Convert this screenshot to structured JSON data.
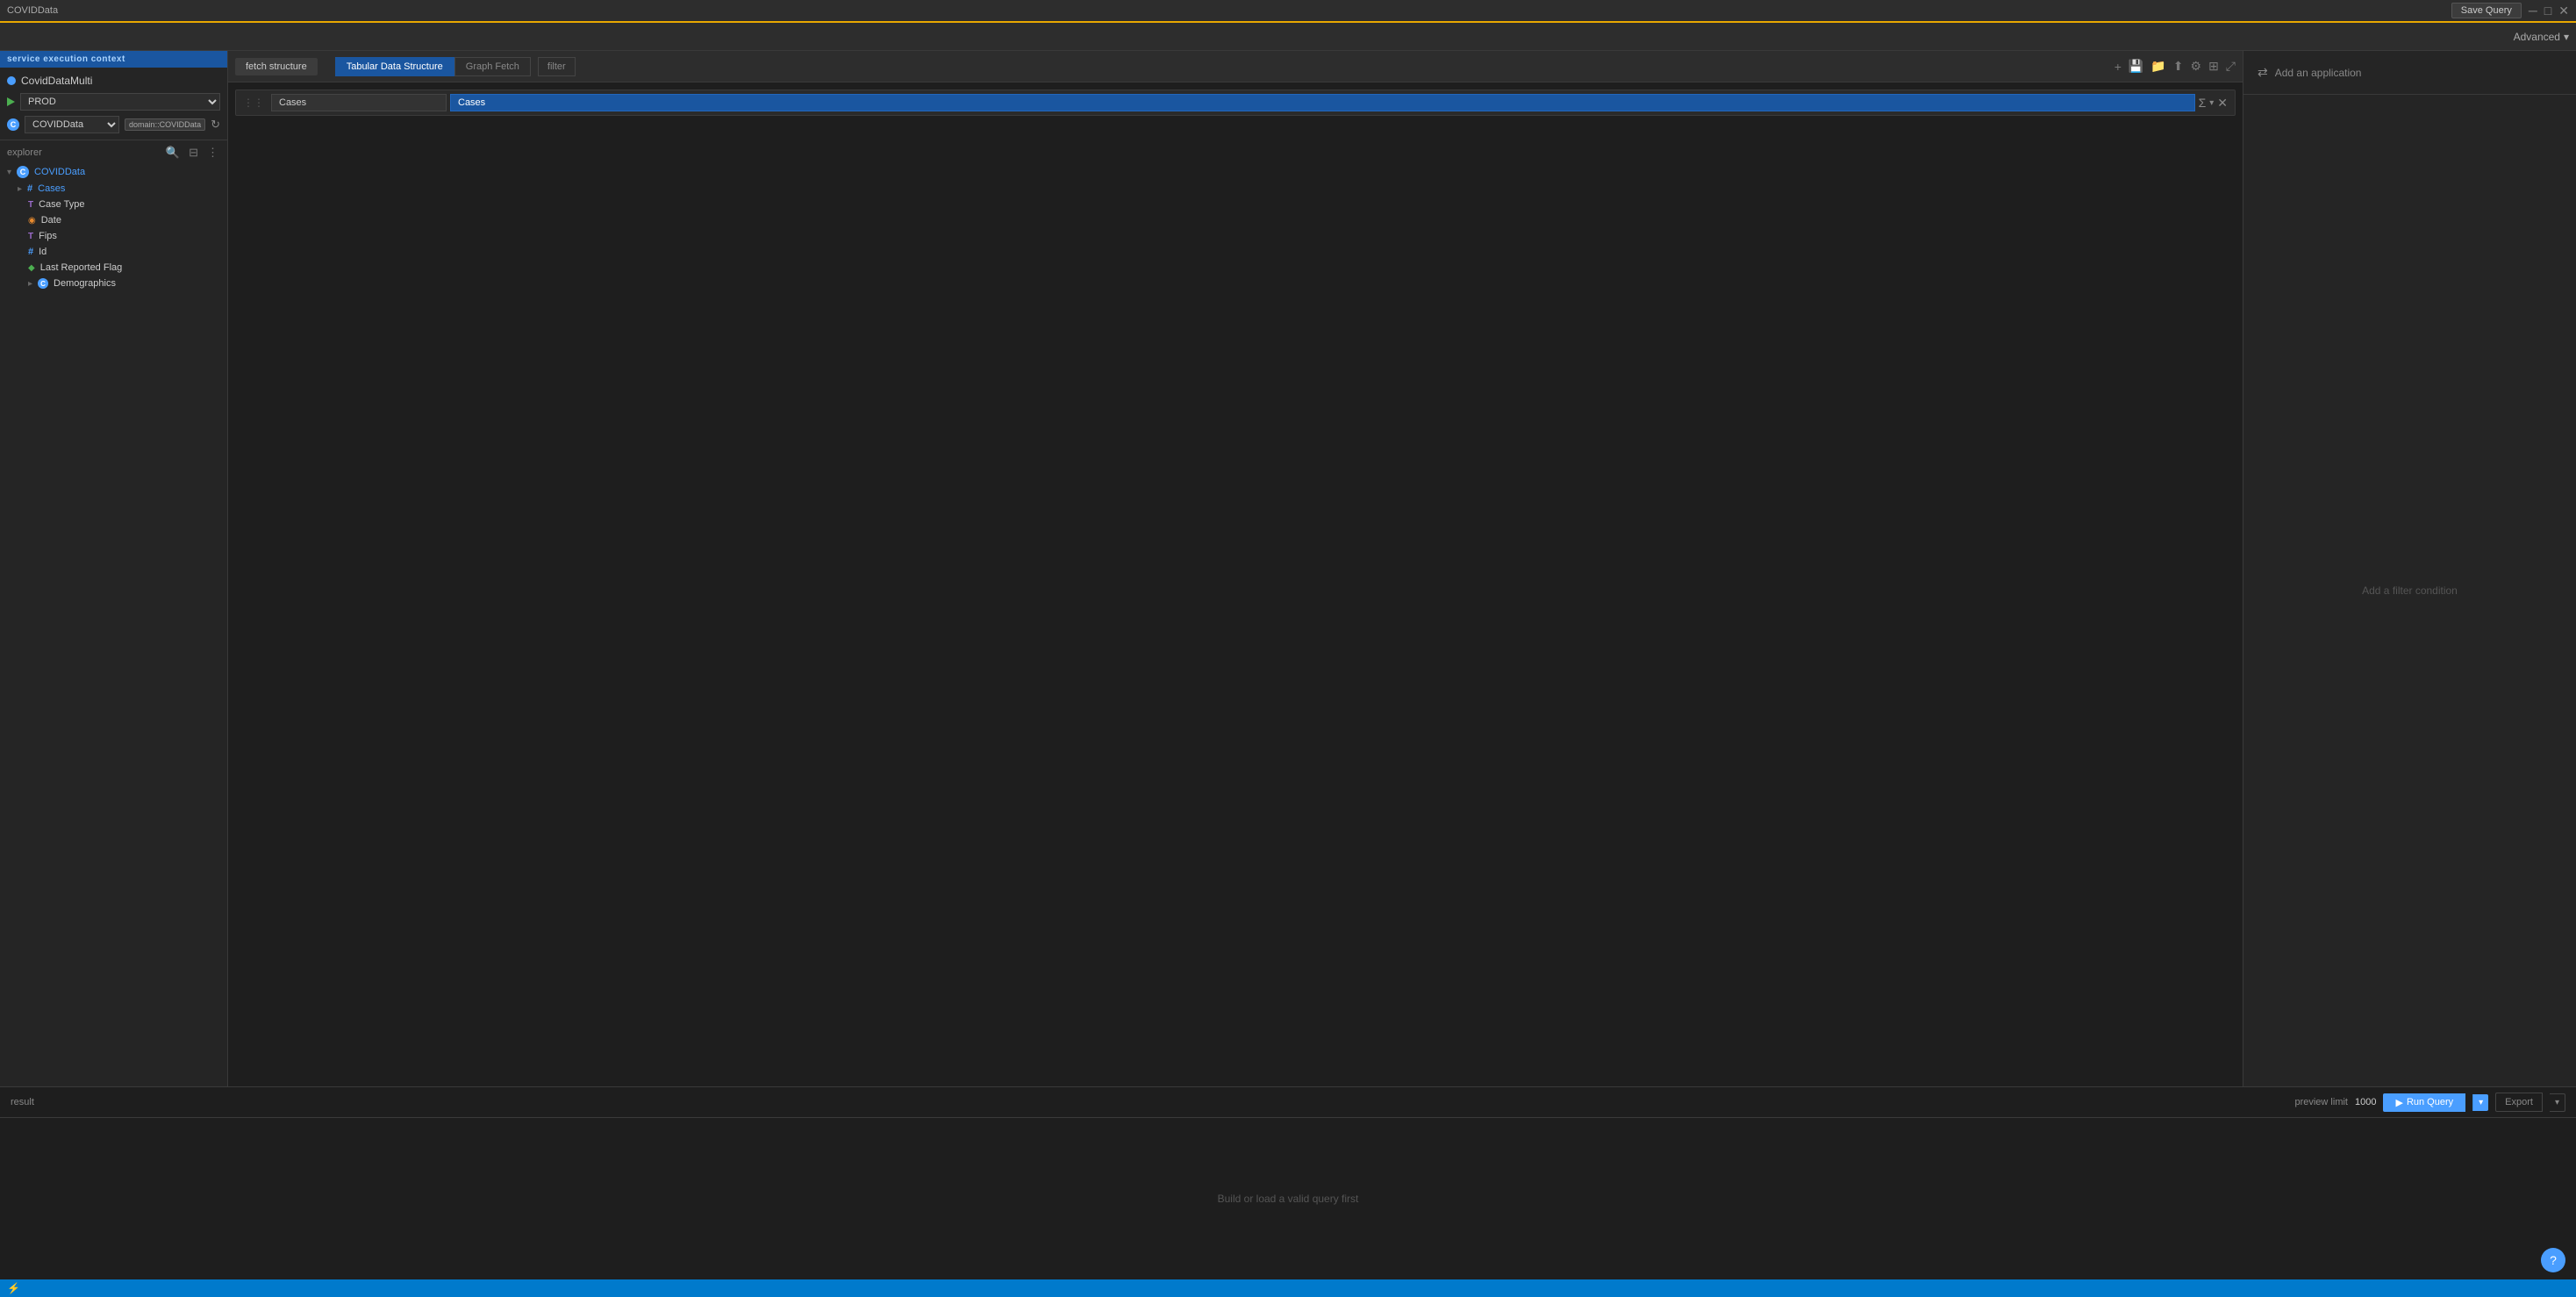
{
  "top_bar": {
    "left_text": "COVIDData",
    "save_query_label": "Save Query",
    "minimize_icon": "─",
    "maximize_icon": "□",
    "close_icon": "✕"
  },
  "advanced_bar": {
    "label": "Advanced",
    "dropdown_icon": "▾"
  },
  "sidebar": {
    "service_context_label": "service execution context",
    "covid_data_multi": "CovidDataMulti",
    "prod_label": "PROD",
    "covid_data_label": "COVIDData",
    "domain_badge": "domain::COVIDData",
    "explorer_label": "explorer",
    "tree": {
      "root": "COVIDData",
      "children": [
        {
          "name": "Cases",
          "type": "hash",
          "level": 1
        },
        {
          "name": "Case Type",
          "type": "T",
          "level": 2
        },
        {
          "name": "Date",
          "type": "date",
          "level": 2
        },
        {
          "name": "Fips",
          "type": "T",
          "level": 2
        },
        {
          "name": "Id",
          "type": "hash",
          "level": 2
        },
        {
          "name": "Last Reported Flag",
          "type": "bool",
          "level": 2
        },
        {
          "name": "Demographics",
          "type": "c",
          "level": 2
        }
      ]
    }
  },
  "fetch_tabs": [
    {
      "label": "fetch structure",
      "active": true
    }
  ],
  "structure_tabs": [
    {
      "label": "Tabular Data Structure",
      "active": true
    },
    {
      "label": "Graph Fetch",
      "active": false
    },
    {
      "label": "filter",
      "active": false
    }
  ],
  "toolbar_icons": [
    {
      "name": "plus-icon",
      "symbol": "+"
    },
    {
      "name": "save-icon",
      "symbol": "💾"
    },
    {
      "name": "folder-icon",
      "symbol": "📁"
    },
    {
      "name": "share-icon",
      "symbol": "⬆"
    },
    {
      "name": "settings-icon",
      "symbol": "⚙"
    },
    {
      "name": "layout-icon",
      "symbol": "⊞"
    },
    {
      "name": "expand-icon",
      "symbol": "⤢"
    }
  ],
  "query_row": {
    "drag_handle": "⋮⋮",
    "label": "Cases",
    "value": "Cases",
    "sigma": "Σ",
    "dropdown": "▾",
    "close": "✕"
  },
  "right_panel": {
    "add_app_icon": "⇄",
    "add_app_text": "Add an application",
    "filter_placeholder": "Add a filter condition"
  },
  "result": {
    "label": "result",
    "preview_label": "preview limit",
    "preview_value": "1000",
    "run_query_label": "Run Query",
    "run_icon": "▶",
    "export_label": "Export",
    "body_text": "Build or load a valid query first"
  },
  "help_circle": {
    "symbol": "?"
  }
}
